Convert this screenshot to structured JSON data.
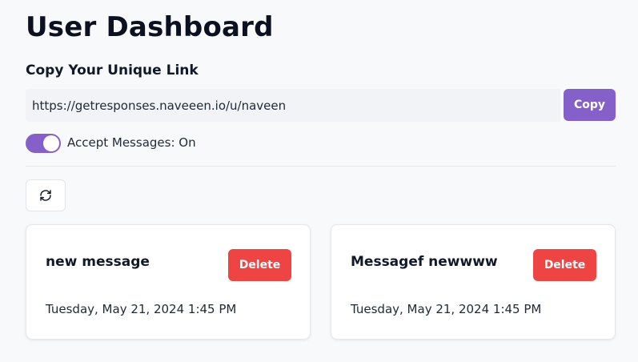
{
  "header": {
    "title": "User Dashboard"
  },
  "link_section": {
    "heading": "Copy Your Unique Link",
    "url": "https://getresponses.naveeen.io/u/naveen",
    "copy_label": "Copy"
  },
  "accept_messages": {
    "label": "Accept Messages: On",
    "enabled": true
  },
  "refresh": {
    "icon": "refresh-icon"
  },
  "messages": [
    {
      "content": "new message",
      "date": "Tuesday, May 21, 2024 1:45 PM",
      "delete_label": "Delete"
    },
    {
      "content": "Messagef newwww",
      "date": "Tuesday, May 21, 2024 1:45 PM",
      "delete_label": "Delete"
    }
  ],
  "colors": {
    "accent": "#8660c9",
    "danger": "#ef4444",
    "background": "#f8f9fb"
  }
}
